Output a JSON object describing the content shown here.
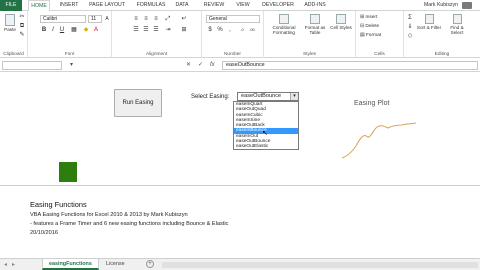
{
  "tabs": [
    "FILE",
    "HOME",
    "INSERT",
    "PAGE LAYOUT",
    "FORMULAS",
    "DATA",
    "REVIEW",
    "VIEW",
    "DEVELOPER",
    "ADD-INS"
  ],
  "user": "Mark Kubiszyn",
  "ribbon": {
    "clipboard": {
      "paste": "Paste",
      "label": "Clipboard"
    },
    "font": {
      "name": "Calibri",
      "size": "11",
      "label": "Font"
    },
    "alignment": {
      "label": "Alignment"
    },
    "number": {
      "format": "General",
      "label": "Number",
      "currency": "$",
      "percent": "%",
      "comma": ","
    },
    "styles": {
      "conditional": "Conditional Formatting",
      "format_table": "Format as Table",
      "cell_styles": "Cell Styles",
      "label": "Styles"
    },
    "cells": {
      "insert": "Insert",
      "delete": "Delete",
      "format": "Format",
      "label": "Cells"
    },
    "editing": {
      "sort": "Sort & Filter",
      "find": "Find & Select",
      "label": "Editing"
    }
  },
  "formula_bar": {
    "name_box": "",
    "fx": "fx",
    "value": "easeOutBounce"
  },
  "sheet": {
    "run_button": "Run Easing",
    "select_label": "Select Easing:",
    "combo_value": "easeOutBounce",
    "list_items": [
      "easeInQuart",
      "easeOutQuad",
      "easeInCubic",
      "easeInSine",
      "easeOutBack",
      "easeInBounce",
      "easeInOut",
      "easeOutBounce",
      "easeOutElastic"
    ],
    "selected_index": 5,
    "plot_title": "Easing Plot",
    "heading": "Easing Functions",
    "line1": "VBA Easing Functions for Excel 2010 & 2013 by Mark Kubiszyn",
    "line2": "- features a Frame Timer and 6 new easing functions including Bounce & Elastic",
    "line3": "20/10/2016"
  },
  "sheet_tabs": [
    "easingFunctions",
    "License"
  ],
  "colors": {
    "excel_green": "#217346",
    "box_green": "#2e7d0f",
    "plot_line": "#d7a35a",
    "selection": "#3399ff"
  }
}
